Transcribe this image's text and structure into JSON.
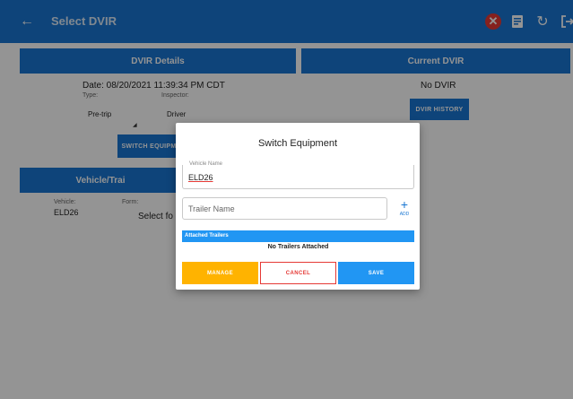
{
  "appbar": {
    "title": "Select DVIR",
    "back_icon": "arrow-left-icon",
    "actions": [
      "close-circle-icon",
      "document-icon",
      "refresh-icon",
      "logout-icon"
    ]
  },
  "dvir_details": {
    "header": "DVIR Details",
    "date": "Date: 08/20/2021 11:39:34 PM CDT",
    "type_label": "Type:",
    "type_value": "Pre-trip",
    "inspector_label": "Inspector:",
    "inspector_value": "Driver",
    "switch_button": "SWITCH EQUIPM"
  },
  "current_dvir": {
    "header": "Current DVIR",
    "value": "No DVIR",
    "history_button": "DVIR HISTORY"
  },
  "vehicle_trailer": {
    "header": "Vehicle/Trai",
    "vehicle_label": "Vehicle:",
    "vehicle_value": "ELD26",
    "form_label": "Form:",
    "form_value": "Select fo"
  },
  "dialog": {
    "title": "Switch Equipment",
    "vehicle_name_label": "Vehicle Name",
    "vehicle_name_value": "ELD26",
    "trailer_placeholder": "Trailer Name",
    "add_label": "ADD",
    "attached_header": "Attached Trailers",
    "no_trailers": "No Trailers Attached",
    "buttons": {
      "manage": "MANAGE",
      "cancel": "CANCEL",
      "save": "SAVE"
    }
  },
  "colors": {
    "primary": "#1976d2",
    "accent_blue": "#2196f3",
    "manage": "#ffb300",
    "cancel": "#e53935"
  }
}
